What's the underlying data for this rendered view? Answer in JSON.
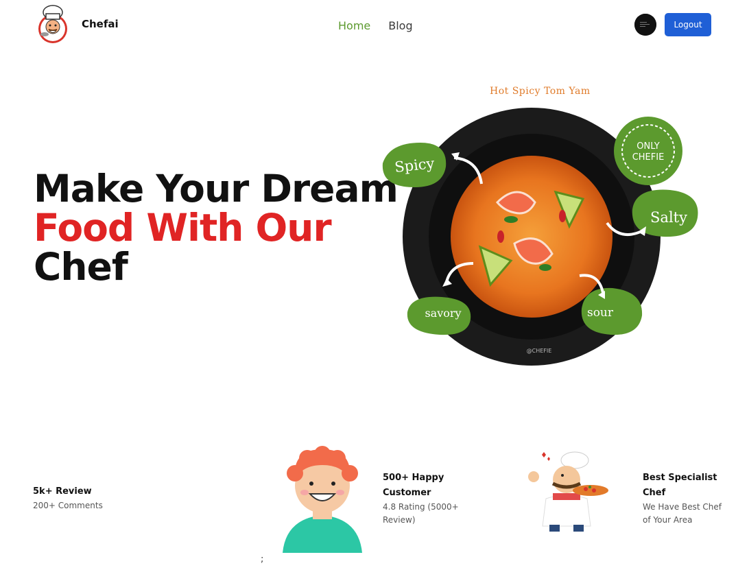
{
  "header": {
    "brand_name": "Chefai",
    "nav": [
      {
        "label": "Home",
        "active": true
      },
      {
        "label": "Blog",
        "active": false
      }
    ],
    "logout_label": "Logout"
  },
  "hero": {
    "line1": "Make Your Dream",
    "line2": "Food With Our",
    "line3": "Chef",
    "highlight_color": "#e02424"
  },
  "dish": {
    "caption": "Hot Spicy Tom Yam",
    "badge_line1": "ONLY",
    "badge_line2": "CHEFIE",
    "tags": [
      "Spicy",
      "Salty",
      "savory",
      "sour"
    ],
    "watermark": "@CHEFIE",
    "tag_color": "#5c9a2e"
  },
  "stats": [
    {
      "title": "5k+ Review",
      "sub": "200+ Comments"
    },
    {
      "title": "500+ Happy Customer",
      "sub": "4.8 Rating (5000+ Review)"
    },
    {
      "title": "Best Specialist Chef",
      "sub": "We Have Best Chef of Your Area"
    }
  ],
  "stray_text": ";",
  "colors": {
    "accent_green": "#5c9a2e",
    "button_blue": "#1f5fd6"
  }
}
